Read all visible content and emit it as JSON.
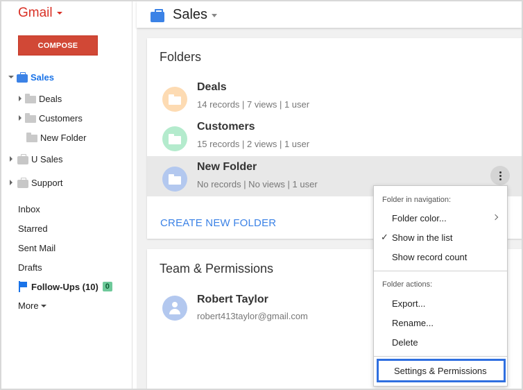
{
  "sidebar": {
    "logo": "Gmail",
    "compose_label": "COMPOSE",
    "groups": [
      {
        "label": "Sales",
        "expanded": true,
        "icon": "briefcase-icon",
        "color": "#3b82e6"
      },
      {
        "label": "U Sales",
        "expanded": false,
        "icon": "briefcase-icon"
      },
      {
        "label": "Support",
        "expanded": false,
        "icon": "briefcase-icon"
      }
    ],
    "subfolders": [
      {
        "label": "Deals",
        "has_children": true
      },
      {
        "label": "Customers",
        "has_children": true
      },
      {
        "label": "New Folder",
        "has_children": false
      }
    ],
    "mail_items": [
      {
        "label": "Inbox"
      },
      {
        "label": "Starred"
      },
      {
        "label": "Sent Mail"
      },
      {
        "label": "Drafts"
      }
    ],
    "followups": {
      "label": "Follow-Ups (10)",
      "badge": "0",
      "icon": "flag-icon"
    },
    "more_label": "More"
  },
  "header": {
    "title": "Sales",
    "icon": "briefcase-icon"
  },
  "folders_card": {
    "title": "Folders",
    "items": [
      {
        "name": "Deals",
        "meta": "14 records | 7 views | 1 user",
        "color": "#fddbb3"
      },
      {
        "name": "Customers",
        "meta": "15 records | 2 views | 1 user",
        "color": "#b4ebcd"
      },
      {
        "name": "New Folder",
        "meta": "No records | No views | 1 user",
        "color": "#b3c8ef"
      }
    ],
    "create_label": "CREATE NEW FOLDER"
  },
  "team_card": {
    "title": "Team & Permissions",
    "members": [
      {
        "name": "Robert Taylor",
        "email": "robert413taylor@gmail.com"
      }
    ]
  },
  "context_menu": {
    "section1_heading": "Folder in navigation:",
    "section1_items": [
      {
        "label": "Folder color...",
        "submenu": true
      },
      {
        "label": "Show in the list",
        "checked": true
      },
      {
        "label": "Show record count"
      }
    ],
    "section2_heading": "Folder actions:",
    "section2_items": [
      {
        "label": "Export..."
      },
      {
        "label": "Rename..."
      },
      {
        "label": "Delete"
      }
    ],
    "highlighted_item": "Settings & Permissions"
  }
}
